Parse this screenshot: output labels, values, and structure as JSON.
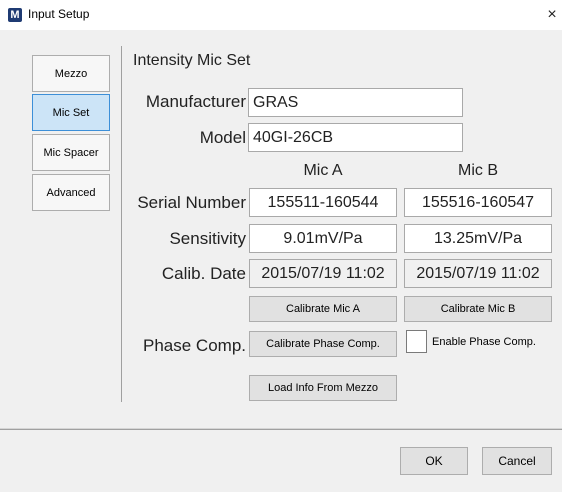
{
  "window": {
    "app_icon_letter": "M",
    "title": "Input Setup",
    "close_glyph": "×"
  },
  "sidebar": {
    "items": [
      {
        "label": "Mezzo",
        "active": false
      },
      {
        "label": "Mic Set",
        "active": true
      },
      {
        "label": "Mic Spacer",
        "active": false
      },
      {
        "label": "Advanced",
        "active": false
      }
    ]
  },
  "section_title": "Intensity Mic Set",
  "manufacturer": {
    "label": "Manufacturer",
    "value": "GRAS"
  },
  "model": {
    "label": "Model",
    "value": "40GI-26CB"
  },
  "columns": {
    "mic_a": "Mic A",
    "mic_b": "Mic B"
  },
  "serial": {
    "label": "Serial Number",
    "mic_a": "155511-160544",
    "mic_b": "155516-160547"
  },
  "sensitivity": {
    "label": "Sensitivity",
    "mic_a": "9.01mV/Pa",
    "mic_b": "13.25mV/Pa"
  },
  "calib_date": {
    "label": "Calib. Date",
    "mic_a": "2015/07/19 11:02",
    "mic_b": "2015/07/19 11:02"
  },
  "buttons": {
    "calibrate_a": "Calibrate Mic A",
    "calibrate_b": "Calibrate Mic B",
    "calibrate_phase": "Calibrate Phase Comp.",
    "load_info": "Load Info From Mezzo",
    "ok": "OK",
    "cancel": "Cancel"
  },
  "phase_comp": {
    "label": "Phase Comp.",
    "enable_label": "Enable Phase Comp.",
    "enabled": false
  },
  "colors": {
    "active_tab_bg": "#cce4f7",
    "active_tab_border": "#3c8fd8",
    "app_icon": "#1f3b73"
  }
}
